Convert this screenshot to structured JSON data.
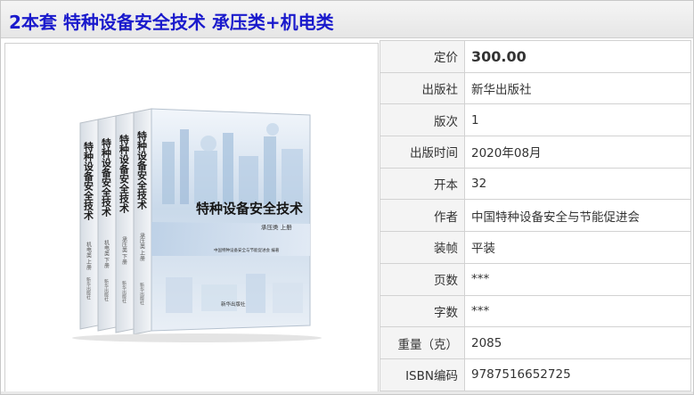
{
  "page": {
    "title": "2本套 特种设备安全技术 承压类+机电类"
  },
  "cover": {
    "main_title": "特种设备安全技术",
    "subtitle": "承压类 上册",
    "author_line": "中国特种设备安全与节能促进会 编著",
    "publisher": "新华出版社",
    "spines": [
      {
        "title": "特种设备安全技术",
        "sub": "机电类 上册",
        "pub": "新华出版社"
      },
      {
        "title": "特种设备安全技术",
        "sub": "机电类 下册",
        "pub": "新华出版社"
      },
      {
        "title": "特种设备安全技术",
        "sub": "承压类 下册",
        "pub": "新华出版社"
      },
      {
        "title": "特种设备安全技术",
        "sub": "承压类 上册",
        "pub": "新华出版社"
      }
    ]
  },
  "specs": [
    {
      "label": "定价",
      "value": "300.00"
    },
    {
      "label": "出版社",
      "value": "新华出版社"
    },
    {
      "label": "版次",
      "value": "1"
    },
    {
      "label": "出版时间",
      "value": "2020年08月"
    },
    {
      "label": "开本",
      "value": "32"
    },
    {
      "label": "作者",
      "value": "中国特种设备安全与节能促进会"
    },
    {
      "label": "装帧",
      "value": "平装"
    },
    {
      "label": "页数",
      "value": "***"
    },
    {
      "label": "字数",
      "value": "***"
    },
    {
      "label": "重量（克）",
      "value": "2085"
    },
    {
      "label": "ISBN编码",
      "value": "9787516652725"
    }
  ],
  "colors": {
    "title": "#1a1acc",
    "label_bg": "#f4f4f4",
    "border": "#d2d2d2"
  }
}
